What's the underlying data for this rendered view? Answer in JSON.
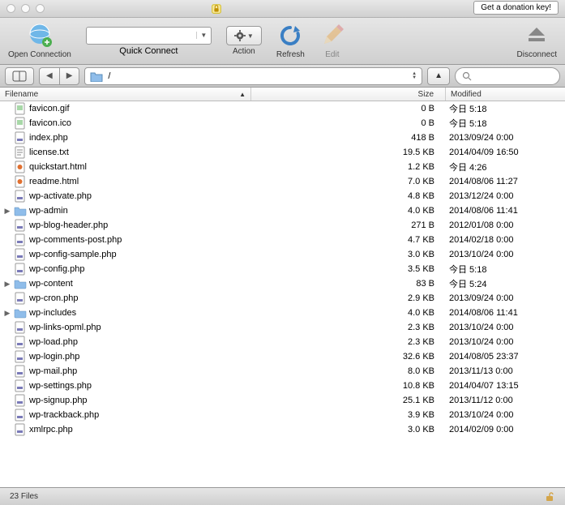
{
  "titlebar": {
    "donation_label": "Get a donation key!"
  },
  "toolbar": {
    "open_connection": "Open Connection",
    "quick_connect": "Quick Connect",
    "action": "Action",
    "refresh": "Refresh",
    "edit": "Edit",
    "disconnect": "Disconnect"
  },
  "path": {
    "current": "/"
  },
  "columns": {
    "filename": "Filename",
    "size": "Size",
    "modified": "Modified"
  },
  "files": [
    {
      "name": "favicon.gif",
      "size": "0 B",
      "modified": "今日 5:18",
      "type": "gif",
      "folder": false
    },
    {
      "name": "favicon.ico",
      "size": "0 B",
      "modified": "今日 5:18",
      "type": "ico",
      "folder": false
    },
    {
      "name": "index.php",
      "size": "418 B",
      "modified": "2013/09/24 0:00",
      "type": "php",
      "folder": false
    },
    {
      "name": "license.txt",
      "size": "19.5 KB",
      "modified": "2014/04/09 16:50",
      "type": "txt",
      "folder": false
    },
    {
      "name": "quickstart.html",
      "size": "1.2 KB",
      "modified": "今日 4:26",
      "type": "html",
      "folder": false
    },
    {
      "name": "readme.html",
      "size": "7.0 KB",
      "modified": "2014/08/06 11:27",
      "type": "html",
      "folder": false
    },
    {
      "name": "wp-activate.php",
      "size": "4.8 KB",
      "modified": "2013/12/24 0:00",
      "type": "php",
      "folder": false
    },
    {
      "name": "wp-admin",
      "size": "4.0 KB",
      "modified": "2014/08/06 11:41",
      "type": "folder",
      "folder": true
    },
    {
      "name": "wp-blog-header.php",
      "size": "271 B",
      "modified": "2012/01/08 0:00",
      "type": "php",
      "folder": false
    },
    {
      "name": "wp-comments-post.php",
      "size": "4.7 KB",
      "modified": "2014/02/18 0:00",
      "type": "php",
      "folder": false
    },
    {
      "name": "wp-config-sample.php",
      "size": "3.0 KB",
      "modified": "2013/10/24 0:00",
      "type": "php",
      "folder": false
    },
    {
      "name": "wp-config.php",
      "size": "3.5 KB",
      "modified": "今日 5:18",
      "type": "php",
      "folder": false
    },
    {
      "name": "wp-content",
      "size": "83 B",
      "modified": "今日 5:24",
      "type": "folder",
      "folder": true
    },
    {
      "name": "wp-cron.php",
      "size": "2.9 KB",
      "modified": "2013/09/24 0:00",
      "type": "php",
      "folder": false
    },
    {
      "name": "wp-includes",
      "size": "4.0 KB",
      "modified": "2014/08/06 11:41",
      "type": "folder",
      "folder": true
    },
    {
      "name": "wp-links-opml.php",
      "size": "2.3 KB",
      "modified": "2013/10/24 0:00",
      "type": "php",
      "folder": false
    },
    {
      "name": "wp-load.php",
      "size": "2.3 KB",
      "modified": "2013/10/24 0:00",
      "type": "php",
      "folder": false
    },
    {
      "name": "wp-login.php",
      "size": "32.6 KB",
      "modified": "2014/08/05 23:37",
      "type": "php",
      "folder": false
    },
    {
      "name": "wp-mail.php",
      "size": "8.0 KB",
      "modified": "2013/11/13 0:00",
      "type": "php",
      "folder": false
    },
    {
      "name": "wp-settings.php",
      "size": "10.8 KB",
      "modified": "2014/04/07 13:15",
      "type": "php",
      "folder": false
    },
    {
      "name": "wp-signup.php",
      "size": "25.1 KB",
      "modified": "2013/11/12 0:00",
      "type": "php",
      "folder": false
    },
    {
      "name": "wp-trackback.php",
      "size": "3.9 KB",
      "modified": "2013/10/24 0:00",
      "type": "php",
      "folder": false
    },
    {
      "name": "xmlrpc.php",
      "size": "3.0 KB",
      "modified": "2014/02/09 0:00",
      "type": "php",
      "folder": false
    }
  ],
  "status": {
    "count": "23 Files"
  }
}
